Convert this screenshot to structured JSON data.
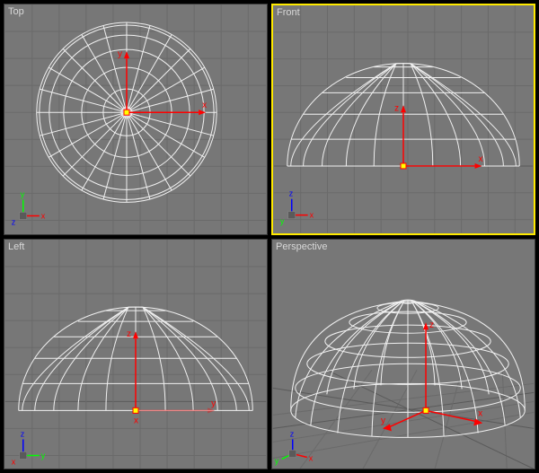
{
  "viewports": {
    "top": {
      "label": "Top",
      "active": false,
      "axes": [
        "x",
        "y",
        "z"
      ]
    },
    "front": {
      "label": "Front",
      "active": true,
      "axes": [
        "x",
        "z",
        "y"
      ]
    },
    "left": {
      "label": "Left",
      "active": false,
      "axes": [
        "y",
        "z",
        "x"
      ]
    },
    "perspective": {
      "label": "Perspective",
      "active": false,
      "axes": [
        "x",
        "y",
        "z"
      ]
    }
  },
  "axis_labels": {
    "x": "x",
    "y": "y",
    "z": "z"
  },
  "colors": {
    "background": "#777777",
    "wireframe": "#f0f0f0",
    "grid": "#6a6a6a",
    "axis_x": "#ff0000",
    "axis_y": "#00ff00",
    "axis_z": "#0000ff",
    "active_border": "#ffea00"
  },
  "object": {
    "type": "hemisphere",
    "segments": 24,
    "rings": 6
  }
}
